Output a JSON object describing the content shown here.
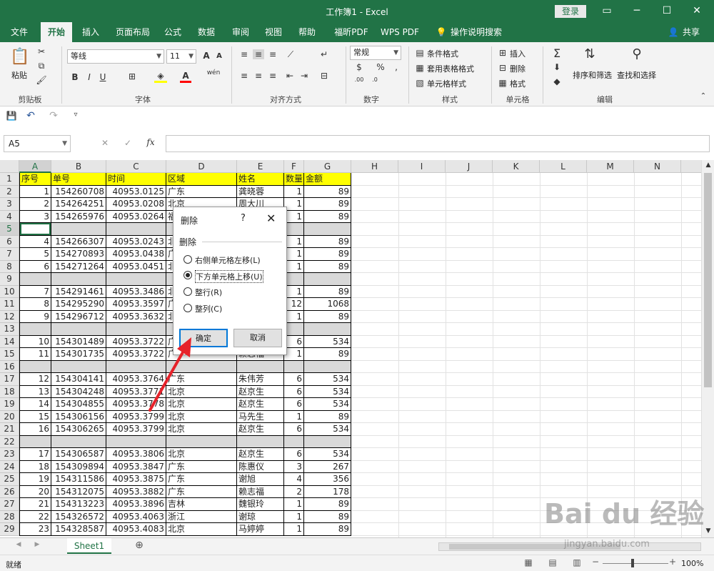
{
  "app": {
    "title": "工作簿1 - Excel",
    "login": "登录",
    "share": "共享"
  },
  "tabs": [
    "文件",
    "开始",
    "插入",
    "页面布局",
    "公式",
    "数据",
    "审阅",
    "视图",
    "帮助",
    "福昕PDF",
    "WPS PDF"
  ],
  "tell_me": "操作说明搜索",
  "ribbon": {
    "paste": "粘贴",
    "font_name": "等线",
    "font_size": "11",
    "number_format": "常规",
    "styles": [
      "条件格式",
      "套用表格格式",
      "单元格样式"
    ],
    "cells": [
      "插入",
      "删除",
      "格式"
    ],
    "edit": [
      "排序和筛选",
      "查找和选择"
    ],
    "groups": [
      "剪贴板",
      "字体",
      "对齐方式",
      "数字",
      "样式",
      "单元格",
      "编辑"
    ],
    "font_btns": [
      "B",
      "I",
      "U"
    ],
    "font_grow": "A",
    "font_color": "A",
    "wen": "wén",
    "sigma": "Σ",
    "percent": "%"
  },
  "namebox": "A5",
  "fx": "fx",
  "columns": [
    "A",
    "B",
    "C",
    "D",
    "E",
    "F",
    "G",
    "H",
    "I",
    "J",
    "K",
    "L",
    "M",
    "N"
  ],
  "rows": [
    {
      "n": "1",
      "type": "header",
      "cells": [
        "序号",
        "单号",
        "时间",
        "区域",
        "姓名",
        "数量",
        "金额"
      ]
    },
    {
      "n": "2",
      "type": "data",
      "cells": [
        "1",
        "154260708",
        "40953.0125",
        "广东",
        "龚晓蓉",
        "1",
        "89"
      ]
    },
    {
      "n": "3",
      "type": "data",
      "cells": [
        "2",
        "154264251",
        "40953.0208",
        "北京",
        "周大川",
        "1",
        "89"
      ]
    },
    {
      "n": "4",
      "type": "data",
      "cells": [
        "3",
        "154265976",
        "40953.0264",
        "福",
        "",
        "1",
        "89"
      ]
    },
    {
      "n": "5",
      "type": "blank",
      "cells": [
        "",
        "",
        "",
        "",
        "",
        "",
        ""
      ]
    },
    {
      "n": "6",
      "type": "data",
      "cells": [
        "4",
        "154266307",
        "40953.0243",
        "北",
        "",
        "1",
        "89"
      ]
    },
    {
      "n": "7",
      "type": "data",
      "cells": [
        "5",
        "154270893",
        "40953.0438",
        "广",
        "",
        "1",
        "89"
      ]
    },
    {
      "n": "8",
      "type": "data",
      "cells": [
        "6",
        "154271264",
        "40953.0451",
        "北",
        "",
        "1",
        "89"
      ]
    },
    {
      "n": "9",
      "type": "blank",
      "cells": [
        "",
        "",
        "",
        "",
        "",
        "",
        ""
      ]
    },
    {
      "n": "10",
      "type": "data",
      "cells": [
        "7",
        "154291461",
        "40953.3486",
        "北",
        "",
        "1",
        "89"
      ]
    },
    {
      "n": "11",
      "type": "data",
      "cells": [
        "8",
        "154295290",
        "40953.3597",
        "广",
        "",
        "12",
        "1068"
      ]
    },
    {
      "n": "12",
      "type": "data",
      "cells": [
        "9",
        "154296712",
        "40953.3632",
        "北",
        "",
        "1",
        "89"
      ]
    },
    {
      "n": "13",
      "type": "blank",
      "cells": [
        "",
        "",
        "",
        "",
        "",
        "",
        ""
      ]
    },
    {
      "n": "14",
      "type": "data",
      "cells": [
        "10",
        "154301489",
        "40953.3722",
        "广",
        "",
        "6",
        "534"
      ]
    },
    {
      "n": "15",
      "type": "data",
      "cells": [
        "11",
        "154301735",
        "40953.3722",
        "广",
        "赖志福",
        "1",
        "89"
      ]
    },
    {
      "n": "16",
      "type": "blank",
      "cells": [
        "",
        "",
        "",
        "",
        "",
        "",
        ""
      ]
    },
    {
      "n": "17",
      "type": "data",
      "cells": [
        "12",
        "154304141",
        "40953.3764",
        "广东",
        "朱伟芳",
        "6",
        "534"
      ]
    },
    {
      "n": "18",
      "type": "data",
      "cells": [
        "13",
        "154304248",
        "40953.3771",
        "北京",
        "赵京生",
        "6",
        "534"
      ]
    },
    {
      "n": "19",
      "type": "data",
      "cells": [
        "14",
        "154304855",
        "40953.3778",
        "北京",
        "赵京生",
        "6",
        "534"
      ]
    },
    {
      "n": "20",
      "type": "data",
      "cells": [
        "15",
        "154306156",
        "40953.3799",
        "北京",
        "马先生",
        "1",
        "89"
      ]
    },
    {
      "n": "21",
      "type": "data",
      "cells": [
        "16",
        "154306265",
        "40953.3799",
        "北京",
        "赵京生",
        "6",
        "534"
      ]
    },
    {
      "n": "22",
      "type": "blank",
      "cells": [
        "",
        "",
        "",
        "",
        "",
        "",
        ""
      ]
    },
    {
      "n": "23",
      "type": "data",
      "cells": [
        "17",
        "154306587",
        "40953.3806",
        "北京",
        "赵京生",
        "6",
        "534"
      ]
    },
    {
      "n": "24",
      "type": "data",
      "cells": [
        "18",
        "154309894",
        "40953.3847",
        "广东",
        "陈惠仪",
        "3",
        "267"
      ]
    },
    {
      "n": "25",
      "type": "data",
      "cells": [
        "19",
        "154311586",
        "40953.3875",
        "广东",
        "谢旭",
        "4",
        "356"
      ]
    },
    {
      "n": "26",
      "type": "data",
      "cells": [
        "20",
        "154312075",
        "40953.3882",
        "广东",
        "赖志福",
        "2",
        "178"
      ]
    },
    {
      "n": "27",
      "type": "data",
      "cells": [
        "21",
        "154313223",
        "40953.3896",
        "吉林",
        "魏银玲",
        "1",
        "89"
      ]
    },
    {
      "n": "28",
      "type": "data",
      "cells": [
        "22",
        "154326572",
        "40953.4063",
        "浙江",
        "谢琼",
        "1",
        "89"
      ]
    },
    {
      "n": "29",
      "type": "data",
      "cells": [
        "23",
        "154328587",
        "40953.4083",
        "北京",
        "马婷婷",
        "1",
        "89"
      ]
    }
  ],
  "dialog": {
    "title": "删除",
    "help": "?",
    "close": "✕",
    "group": "删除",
    "options": [
      "右侧单元格左移(L)",
      "下方单元格上移(U)",
      "整行(R)",
      "整列(C)"
    ],
    "selected_index": 1,
    "ok": "确定",
    "cancel": "取消"
  },
  "sheet_tab": "Sheet1",
  "status": {
    "ready": "就绪",
    "zoom": "100%"
  },
  "watermark": {
    "main": "Bai du 经验",
    "sub": "jingyan.baidu.com"
  }
}
